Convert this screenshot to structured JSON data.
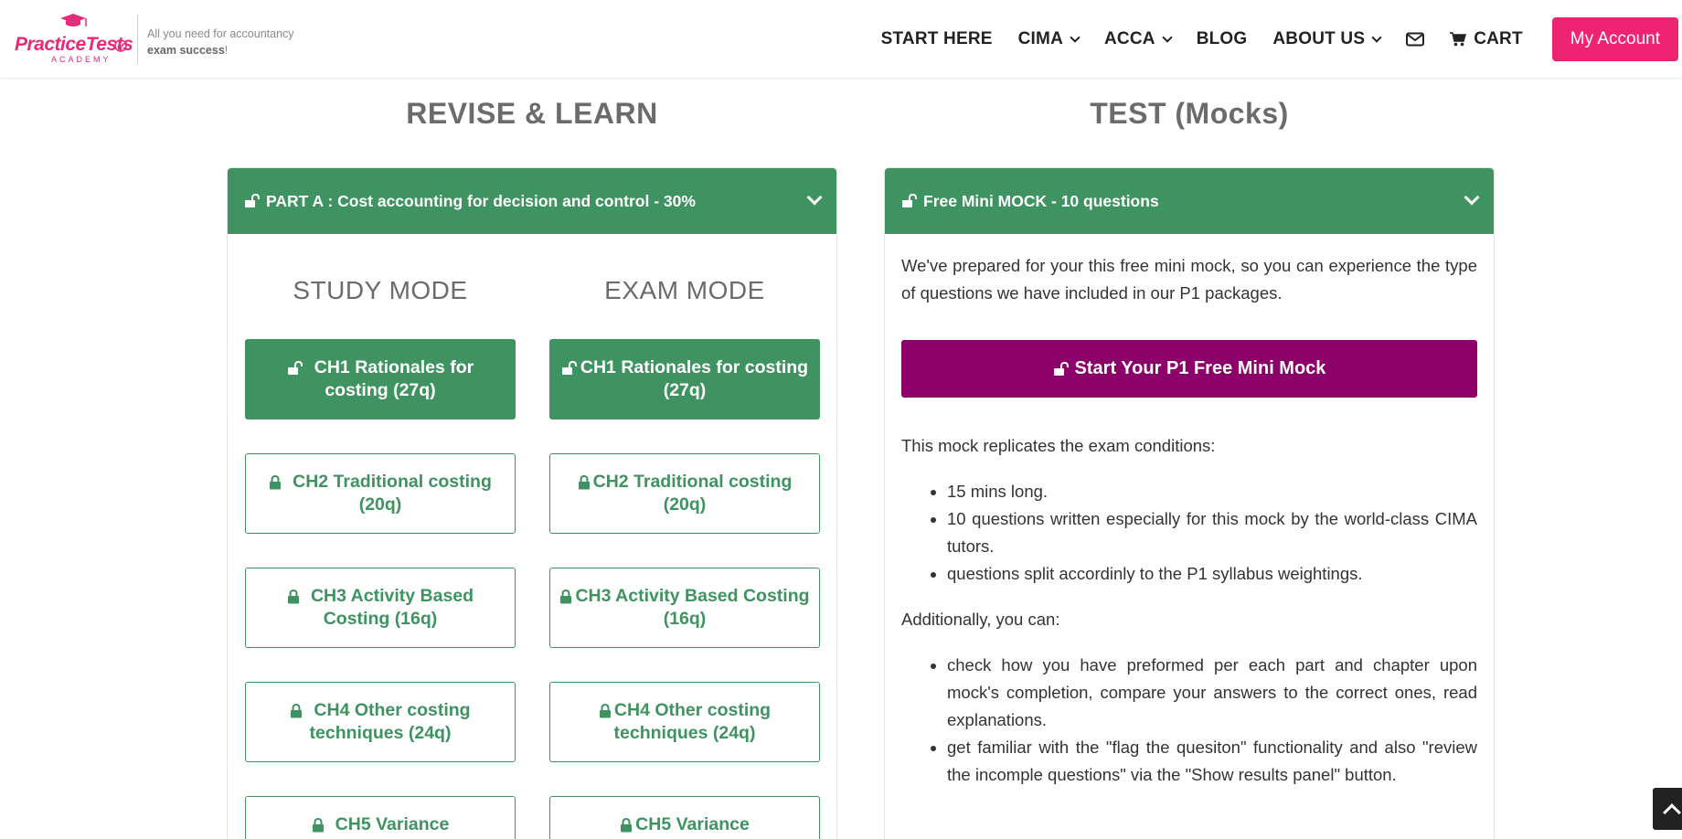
{
  "brand": {
    "logo_word_practice": "Practice",
    "logo_word_tests": "Tests",
    "logo_academy": "ACADEMY",
    "tagline_line1": "All you need for accountancy",
    "tagline_bold": "exam success",
    "tagline_end": "!",
    "primary_color": "#3e9361",
    "accent_color": "#ee2372",
    "mock_color": "#8b0069"
  },
  "nav": {
    "start_here": "START HERE",
    "cima": "CIMA",
    "acca": "ACCA",
    "blog": "BLOG",
    "about_us": "ABOUT US",
    "cart": "CART",
    "my_account": "My Account"
  },
  "left": {
    "heading": "REVISE & LEARN",
    "panel_title": "PART A : Cost accounting for decision and control - 30%",
    "study_mode": "STUDY MODE",
    "exam_mode": "EXAM MODE",
    "chapters": [
      {
        "label": "CH1 Rationales for costing (27q)",
        "locked": false
      },
      {
        "label": "CH2 Traditional costing (20q)",
        "locked": true
      },
      {
        "label": "CH3 Activity Based Costing (16q)",
        "locked": true
      },
      {
        "label": "CH4 Other costing techniques (24q)",
        "locked": true
      },
      {
        "label": "CH5 Variance",
        "locked": true
      }
    ]
  },
  "right": {
    "heading": "TEST (Mocks)",
    "panel_title": "Free Mini MOCK - 10 questions",
    "intro": "We've prepared for your this free mini mock, so you can experience the type of questions we have included in our P1 packages.",
    "start_button": "Start Your P1 Free Mini Mock",
    "replicates": "This mock replicates the exam conditions:",
    "conditions": [
      "15 mins long.",
      "10 questions written especially for this mock by the world-class CIMA tutors.",
      "questions split accordinly to the P1 syllabus weightings."
    ],
    "additionally": "Additionally, you can:",
    "extras": [
      "check how you have preformed per each part and chapter upon mock's completion, compare your answers to the correct ones, read explanations.",
      "get familiar with the \"flag the quesiton\" functionality and also \"review the incomple questions\" via the \"Show results panel\" button."
    ]
  }
}
